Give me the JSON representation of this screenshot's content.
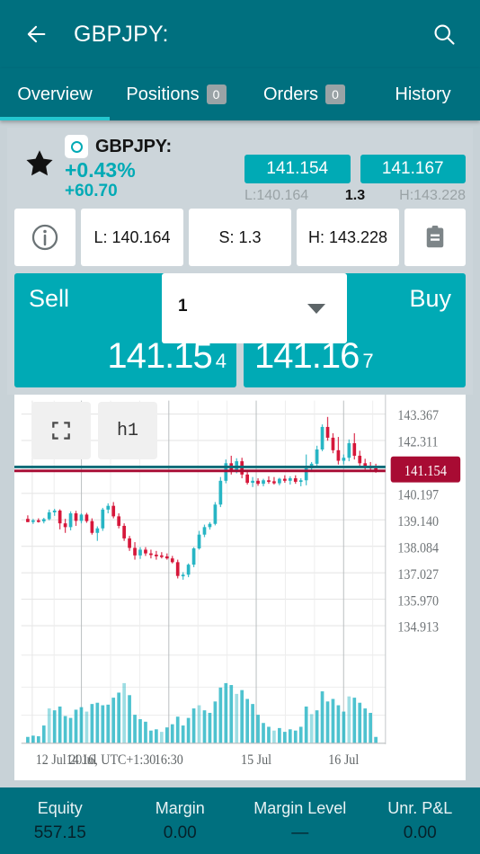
{
  "appbar": {
    "title": "GBPJPY:",
    "back_icon": "arrow-left-icon",
    "search_icon": "search-icon"
  },
  "tabs": [
    {
      "label": "Overview",
      "badge": null,
      "active": true
    },
    {
      "label": "Positions",
      "badge": "0",
      "active": false
    },
    {
      "label": "Orders",
      "badge": "0",
      "active": false
    },
    {
      "label": "History",
      "badge": null,
      "active": false
    }
  ],
  "quote": {
    "favorite_icon": "star-icon",
    "symbol_icon": "circle-icon",
    "symbol": "GBPJPY:",
    "change_percent": "+0.43%",
    "change_points": "+60.70",
    "bid_chip": "141.154",
    "ask_chip": "141.167",
    "low_inline": "L:140.164",
    "spread_inline": "1.3",
    "high_inline": "H:143.228"
  },
  "info_buttons": [
    {
      "name": "info-button",
      "icon": "info-icon",
      "label": ""
    },
    {
      "name": "low-button",
      "icon": null,
      "label": "L: 140.164"
    },
    {
      "name": "spread-button",
      "icon": null,
      "label": "S: 1.3"
    },
    {
      "name": "high-button",
      "icon": null,
      "label": "H: 143.228"
    },
    {
      "name": "notes-button",
      "icon": "clipboard-icon",
      "label": ""
    }
  ],
  "trade": {
    "sell_label": "Sell",
    "sell_price_main": "141.15",
    "sell_price_frac": "4",
    "sell_arrow_icon": "arrow-up-icon",
    "buy_label": "Buy",
    "buy_price_main": "141.16",
    "buy_price_frac": "7",
    "buy_arrow_icon": "arrow-up-icon",
    "volume_value": "1",
    "volume_caret_icon": "chevron-down-icon"
  },
  "chart_toolbar": {
    "fullscreen_icon": "fullscreen-icon",
    "timeframe_label": "h1"
  },
  "footer": [
    {
      "label": "Equity",
      "value": "557.15"
    },
    {
      "label": "Margin",
      "value": "0.00"
    },
    {
      "label": "Margin Level",
      "value": "—"
    },
    {
      "label": "Unr. P&L",
      "value": "0.00"
    }
  ],
  "colors": {
    "brand_dark_teal": "#00707f",
    "brand_teal": "#00aab5",
    "accent_cyan": "#25c6cf",
    "panel_grey": "#ccd5da",
    "bull_candle": "#27b5c4",
    "bear_candle": "#d6173a",
    "price_marker": "#a80b33"
  },
  "chart_data": {
    "type": "candlestick",
    "title": "",
    "timeframe": "h1",
    "current_price_label": "141.154",
    "y_ticks": [
      "143.367",
      "142.311",
      "141.154",
      "140.197",
      "139.140",
      "138.084",
      "137.027",
      "135.970",
      "134.913"
    ],
    "ylim": [
      134.3,
      143.9
    ],
    "x_ticks": [
      "12 Jul 2016, UTC+1:30",
      "14 Jul",
      "16:30",
      "15 Jul",
      "16 Jul"
    ],
    "x_tick_positions": [
      0.03,
      0.165,
      0.405,
      0.645,
      0.885
    ],
    "grid": true,
    "candles": [
      {
        "o": 139.18,
        "h": 139.32,
        "l": 139.05,
        "c": 139.05,
        "v": 0.1
      },
      {
        "o": 139.07,
        "h": 139.18,
        "l": 138.98,
        "c": 139.12,
        "v": 0.12
      },
      {
        "o": 139.12,
        "h": 139.2,
        "l": 139.03,
        "c": 139.08,
        "v": 0.11
      },
      {
        "o": 139.08,
        "h": 139.22,
        "l": 139.0,
        "c": 139.17,
        "v": 0.28
      },
      {
        "o": 139.17,
        "h": 139.55,
        "l": 139.12,
        "c": 139.44,
        "v": 0.55
      },
      {
        "o": 139.44,
        "h": 139.58,
        "l": 139.3,
        "c": 139.51,
        "v": 0.52
      },
      {
        "o": 139.51,
        "h": 139.56,
        "l": 138.76,
        "c": 139.0,
        "v": 0.58
      },
      {
        "o": 139.0,
        "h": 139.18,
        "l": 138.62,
        "c": 138.85,
        "v": 0.43
      },
      {
        "o": 138.85,
        "h": 139.48,
        "l": 138.72,
        "c": 139.4,
        "v": 0.4
      },
      {
        "o": 139.4,
        "h": 139.5,
        "l": 138.9,
        "c": 139.1,
        "v": 0.53
      },
      {
        "o": 139.1,
        "h": 139.4,
        "l": 139.0,
        "c": 139.35,
        "v": 0.57
      },
      {
        "o": 139.35,
        "h": 139.42,
        "l": 139.02,
        "c": 139.09,
        "v": 0.5
      },
      {
        "o": 139.09,
        "h": 139.2,
        "l": 138.55,
        "c": 138.62,
        "v": 0.62
      },
      {
        "o": 138.62,
        "h": 138.88,
        "l": 138.3,
        "c": 138.8,
        "v": 0.64
      },
      {
        "o": 138.8,
        "h": 139.62,
        "l": 138.7,
        "c": 139.55,
        "v": 0.6
      },
      {
        "o": 139.55,
        "h": 139.8,
        "l": 139.4,
        "c": 139.7,
        "v": 0.61
      },
      {
        "o": 139.7,
        "h": 139.85,
        "l": 139.2,
        "c": 139.28,
        "v": 0.72
      },
      {
        "o": 139.28,
        "h": 139.4,
        "l": 138.8,
        "c": 138.9,
        "v": 0.8
      },
      {
        "o": 138.9,
        "h": 139.0,
        "l": 138.3,
        "c": 138.4,
        "v": 0.95
      },
      {
        "o": 138.4,
        "h": 138.5,
        "l": 137.9,
        "c": 138.02,
        "v": 0.76
      },
      {
        "o": 138.02,
        "h": 138.25,
        "l": 137.55,
        "c": 137.72,
        "v": 0.45
      },
      {
        "o": 137.72,
        "h": 138.05,
        "l": 137.58,
        "c": 137.95,
        "v": 0.38
      },
      {
        "o": 137.95,
        "h": 138.05,
        "l": 137.7,
        "c": 137.8,
        "v": 0.34
      },
      {
        "o": 137.8,
        "h": 137.95,
        "l": 137.6,
        "c": 137.75,
        "v": 0.2
      },
      {
        "o": 137.75,
        "h": 137.9,
        "l": 137.55,
        "c": 137.72,
        "v": 0.22
      },
      {
        "o": 137.72,
        "h": 137.85,
        "l": 137.6,
        "c": 137.68,
        "v": 0.18
      },
      {
        "o": 137.68,
        "h": 137.8,
        "l": 137.55,
        "c": 137.6,
        "v": 0.25
      },
      {
        "o": 137.6,
        "h": 137.7,
        "l": 137.4,
        "c": 137.45,
        "v": 0.3
      },
      {
        "o": 137.45,
        "h": 137.55,
        "l": 136.8,
        "c": 136.9,
        "v": 0.42
      },
      {
        "o": 136.9,
        "h": 137.05,
        "l": 136.75,
        "c": 136.95,
        "v": 0.28
      },
      {
        "o": 136.95,
        "h": 137.4,
        "l": 136.85,
        "c": 137.35,
        "v": 0.4
      },
      {
        "o": 137.35,
        "h": 138.05,
        "l": 137.25,
        "c": 138.0,
        "v": 0.55
      },
      {
        "o": 138.0,
        "h": 138.7,
        "l": 137.95,
        "c": 138.55,
        "v": 0.6
      },
      {
        "o": 138.55,
        "h": 138.95,
        "l": 138.45,
        "c": 138.85,
        "v": 0.52
      },
      {
        "o": 138.85,
        "h": 139.05,
        "l": 138.75,
        "c": 138.98,
        "v": 0.48
      },
      {
        "o": 138.98,
        "h": 139.85,
        "l": 138.92,
        "c": 139.75,
        "v": 0.66
      },
      {
        "o": 139.75,
        "h": 140.85,
        "l": 139.65,
        "c": 140.7,
        "v": 0.88
      },
      {
        "o": 140.7,
        "h": 141.55,
        "l": 140.6,
        "c": 141.4,
        "v": 0.95
      },
      {
        "o": 141.4,
        "h": 141.7,
        "l": 140.95,
        "c": 141.05,
        "v": 0.92
      },
      {
        "o": 141.05,
        "h": 141.6,
        "l": 141.0,
        "c": 141.48,
        "v": 0.78
      },
      {
        "o": 141.48,
        "h": 141.62,
        "l": 140.8,
        "c": 140.95,
        "v": 0.84
      },
      {
        "o": 140.95,
        "h": 141.05,
        "l": 140.55,
        "c": 140.62,
        "v": 0.7
      },
      {
        "o": 140.62,
        "h": 140.85,
        "l": 140.45,
        "c": 140.7,
        "v": 0.62
      },
      {
        "o": 140.7,
        "h": 140.8,
        "l": 140.5,
        "c": 140.58,
        "v": 0.45
      },
      {
        "o": 140.58,
        "h": 140.78,
        "l": 140.48,
        "c": 140.72,
        "v": 0.32
      },
      {
        "o": 140.72,
        "h": 140.88,
        "l": 140.58,
        "c": 140.68,
        "v": 0.26
      },
      {
        "o": 140.68,
        "h": 140.85,
        "l": 140.55,
        "c": 140.6,
        "v": 0.2
      },
      {
        "o": 140.6,
        "h": 140.82,
        "l": 140.52,
        "c": 140.78,
        "v": 0.24
      },
      {
        "o": 140.78,
        "h": 140.92,
        "l": 140.62,
        "c": 140.7,
        "v": 0.18
      },
      {
        "o": 140.7,
        "h": 140.88,
        "l": 140.55,
        "c": 140.8,
        "v": 0.22
      },
      {
        "o": 140.8,
        "h": 140.92,
        "l": 140.58,
        "c": 140.66,
        "v": 0.2
      },
      {
        "o": 140.66,
        "h": 140.8,
        "l": 140.48,
        "c": 140.72,
        "v": 0.26
      },
      {
        "o": 140.72,
        "h": 141.75,
        "l": 140.52,
        "c": 141.2,
        "v": 0.58
      },
      {
        "o": 141.2,
        "h": 141.45,
        "l": 141.05,
        "c": 141.38,
        "v": 0.46
      },
      {
        "o": 141.38,
        "h": 142.1,
        "l": 141.3,
        "c": 141.95,
        "v": 0.52
      },
      {
        "o": 141.95,
        "h": 142.95,
        "l": 141.88,
        "c": 142.85,
        "v": 0.82
      },
      {
        "o": 142.85,
        "h": 143.25,
        "l": 142.3,
        "c": 142.42,
        "v": 0.66
      },
      {
        "o": 142.42,
        "h": 142.6,
        "l": 141.8,
        "c": 141.92,
        "v": 0.7
      },
      {
        "o": 141.92,
        "h": 142.45,
        "l": 141.35,
        "c": 141.5,
        "v": 0.6
      },
      {
        "o": 141.5,
        "h": 141.75,
        "l": 141.35,
        "c": 141.62,
        "v": 0.5
      },
      {
        "o": 141.62,
        "h": 142.35,
        "l": 141.48,
        "c": 142.2,
        "v": 0.74
      },
      {
        "o": 142.2,
        "h": 142.6,
        "l": 141.55,
        "c": 141.7,
        "v": 0.72
      },
      {
        "o": 141.7,
        "h": 141.9,
        "l": 141.3,
        "c": 141.4,
        "v": 0.64
      },
      {
        "o": 141.4,
        "h": 141.58,
        "l": 141.15,
        "c": 141.28,
        "v": 0.55
      },
      {
        "o": 141.28,
        "h": 141.45,
        "l": 141.05,
        "c": 141.2,
        "v": 0.48
      },
      {
        "o": 141.2,
        "h": 141.38,
        "l": 141.02,
        "c": 141.16,
        "v": 0.1
      }
    ],
    "price_line": 141.154
  }
}
